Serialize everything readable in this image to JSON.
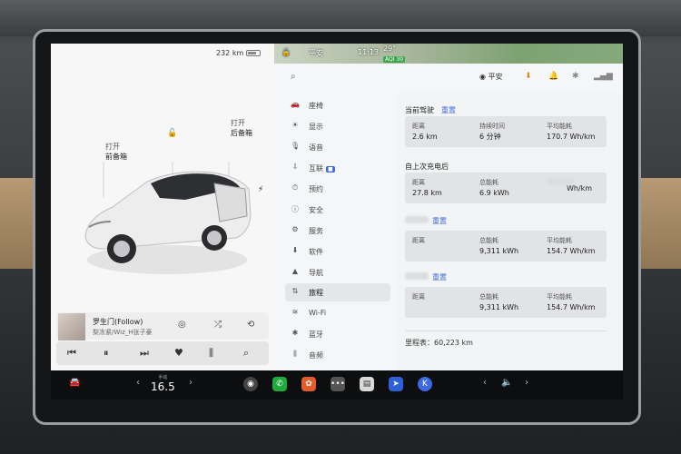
{
  "status": {
    "range": "232 km",
    "user": "平安",
    "time": "11:13",
    "temp": "29°",
    "aqi": "AQI 30"
  },
  "car": {
    "frunk_action": "打开",
    "frunk_label": "前备箱",
    "trunk_action": "打开",
    "trunk_label": "后备箱"
  },
  "media": {
    "song": "罗生门(Follow)",
    "artist": "梨冻紧/Wiz_H张子豪"
  },
  "search": {
    "user": "平安"
  },
  "menu": [
    {
      "icon": "car-icon",
      "glyph": "🚗",
      "label": "座椅"
    },
    {
      "icon": "display-icon",
      "glyph": "☀",
      "label": "显示"
    },
    {
      "icon": "mic-icon",
      "glyph": "🎙",
      "label": "语音"
    },
    {
      "icon": "connect-icon",
      "glyph": "⇩",
      "label": "互联"
    },
    {
      "icon": "schedule-icon",
      "glyph": "⏱",
      "label": "预约"
    },
    {
      "icon": "safety-icon",
      "glyph": "ⓘ",
      "label": "安全"
    },
    {
      "icon": "service-icon",
      "glyph": "⚙",
      "label": "服务"
    },
    {
      "icon": "software-icon",
      "glyph": "⬇",
      "label": "软件"
    },
    {
      "icon": "nav-icon",
      "glyph": "▲",
      "label": "导航"
    },
    {
      "icon": "trips-icon",
      "glyph": "⇅",
      "label": "旅程"
    },
    {
      "icon": "wifi-icon",
      "glyph": "≋",
      "label": "Wi-Fi"
    },
    {
      "icon": "bluetooth-icon",
      "glyph": "✱",
      "label": "蓝牙"
    },
    {
      "icon": "audio-icon",
      "glyph": "⫼",
      "label": "音频"
    }
  ],
  "trips": {
    "current_title": "当前驾驶",
    "reset": "重置",
    "current": {
      "distance_label": "距离",
      "distance": "2.6 km",
      "duration_label": "持续时间",
      "duration": "6 分钟",
      "avg_label": "平均能耗",
      "avg": "170.7 Wh/km"
    },
    "since_charge_title": "自上次充电后",
    "since_charge": {
      "distance_label": "距离",
      "distance": "27.8 km",
      "energy_label": "总能耗",
      "energy": "6.9 kWh",
      "avg": "Wh/km"
    },
    "trip_a": {
      "reset": "重置",
      "distance_label": "距离",
      "energy_label": "总能耗",
      "energy": "9,311 kWh",
      "avg_label": "平均能耗",
      "avg": "154.7 Wh/km"
    },
    "trip_b": {
      "reset": "重置",
      "distance_label": "距离",
      "energy_label": "总能耗",
      "energy": "9,311 kWh",
      "avg_label": "平均能耗",
      "avg": "154.7 Wh/km"
    },
    "odometer": "里程表：60,223 km"
  },
  "dock": {
    "temp": "16.5",
    "temp_mode": "手动"
  }
}
